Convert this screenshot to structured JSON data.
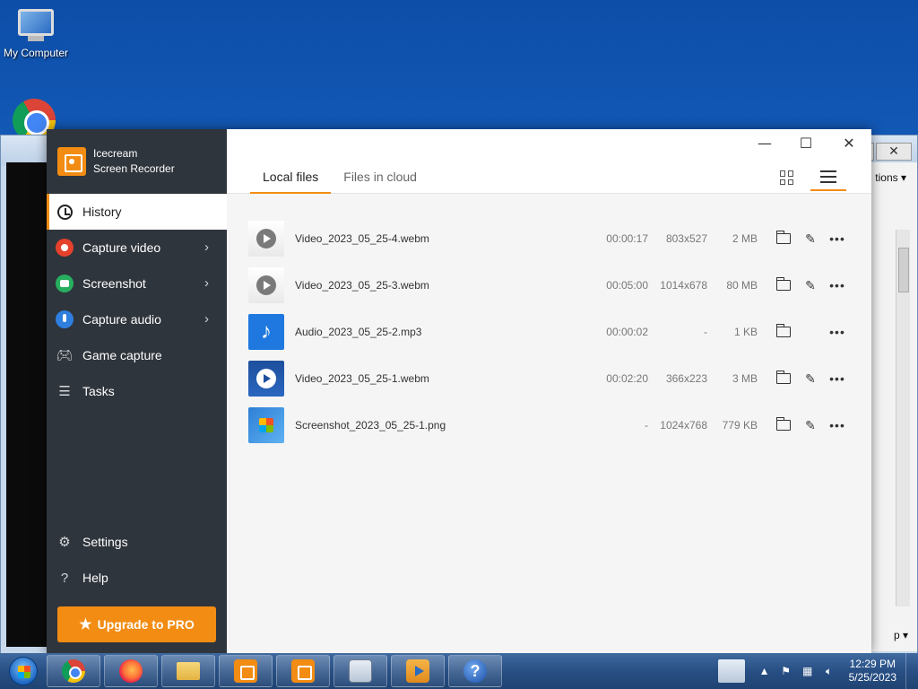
{
  "desktop": {
    "icons": [
      {
        "label": "My Computer"
      }
    ],
    "background_window": {
      "partial_label": "tions",
      "partial_bottom_label": "p"
    }
  },
  "app": {
    "brand": {
      "line1": "Icecream",
      "line2": "Screen Recorder"
    },
    "nav": {
      "history": "History",
      "capture_video": "Capture video",
      "screenshot": "Screenshot",
      "capture_audio": "Capture audio",
      "game_capture": "Game capture",
      "tasks": "Tasks",
      "settings": "Settings",
      "help": "Help"
    },
    "upgrade_label": "Upgrade to PRO",
    "tabs": [
      {
        "label": "Local files",
        "active": true
      },
      {
        "label": "Files in cloud",
        "active": false
      }
    ],
    "files": [
      {
        "name": "Video_2023_05_25-4.webm",
        "duration": "00:00:17",
        "resolution": "803x527",
        "size": "2 MB",
        "type": "video-light",
        "editable": true
      },
      {
        "name": "Video_2023_05_25-3.webm",
        "duration": "00:05:00",
        "resolution": "1014x678",
        "size": "80 MB",
        "type": "video-light",
        "editable": true
      },
      {
        "name": "Audio_2023_05_25-2.mp3",
        "duration": "00:00:02",
        "resolution": "-",
        "size": "1 KB",
        "type": "audio",
        "editable": false
      },
      {
        "name": "Video_2023_05_25-1.webm",
        "duration": "00:02:20",
        "resolution": "366x223",
        "size": "3 MB",
        "type": "video-dark",
        "editable": true
      },
      {
        "name": "Screenshot_2023_05_25-1.png",
        "duration": "-",
        "resolution": "1024x768",
        "size": "779 KB",
        "type": "image",
        "editable": true
      }
    ],
    "accent_color": "#f28c13",
    "sidebar_color": "#2f353c"
  },
  "taskbar": {
    "clock_time": "12:29 PM",
    "clock_date": "5/25/2023",
    "help_glyph": "?"
  }
}
